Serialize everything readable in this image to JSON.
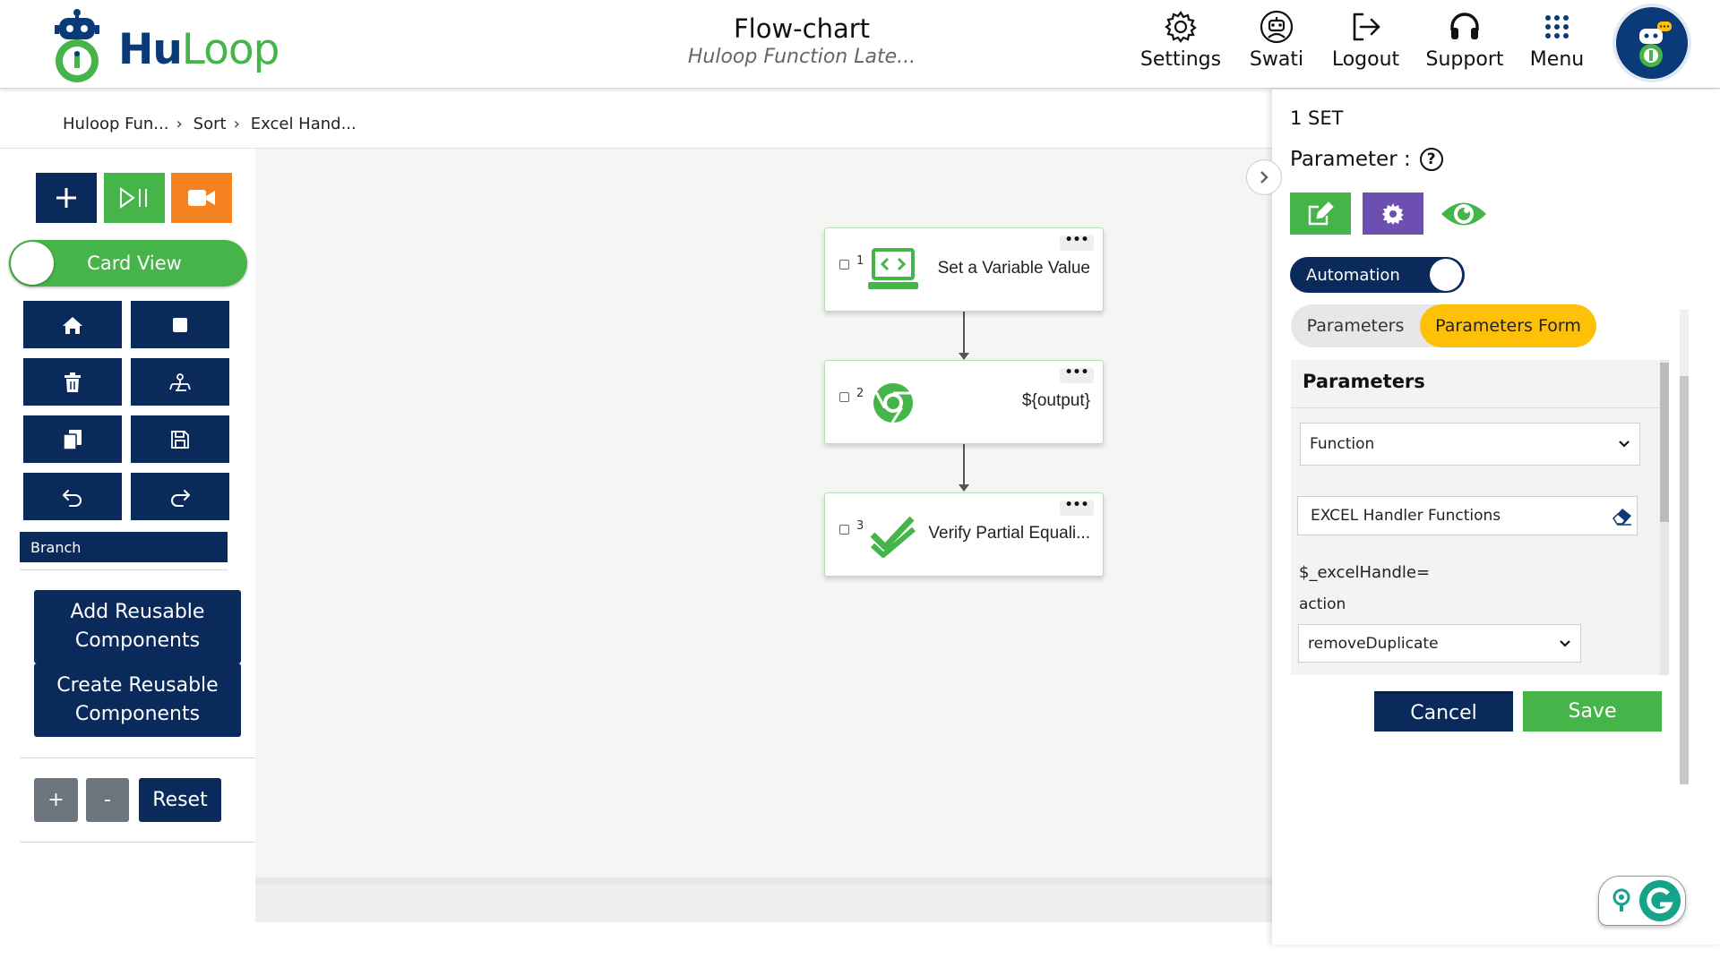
{
  "header": {
    "logo": {
      "hu": "Hu",
      "loop": "Loop"
    },
    "title": "Flow-chart",
    "subtitle": "Huloop Function Late...",
    "nav": [
      {
        "label": "Settings",
        "icon": "gear-icon"
      },
      {
        "label": "Swati",
        "icon": "robot-user-icon"
      },
      {
        "label": "Logout",
        "icon": "logout-icon"
      },
      {
        "label": "Support",
        "icon": "headset-icon"
      },
      {
        "label": "Menu",
        "icon": "grid-menu-icon"
      }
    ]
  },
  "breadcrumb": [
    "Huloop Fun...",
    "Sort",
    "Excel Hand..."
  ],
  "toolbar": {
    "card_view_label": "Card View",
    "branch_label": "Branch",
    "add_reusable": "Add Reusable Components",
    "create_reusable": "Create Reusable Components",
    "zoom_in": "+",
    "zoom_out": "-",
    "reset": "Reset"
  },
  "flow": {
    "nodes": [
      {
        "num": "1",
        "label": "Set a Variable Value",
        "icon": "laptop-code-icon"
      },
      {
        "num": "2",
        "label": "${output}",
        "icon": "chrome-icon"
      },
      {
        "num": "3",
        "label": "Verify Partial Equali...",
        "icon": "double-check-icon"
      }
    ],
    "menu_label": "•••"
  },
  "panel": {
    "set_label": "1 SET",
    "parameter_label": "Parameter :",
    "help": "?",
    "automation_label": "Automation",
    "tabs": {
      "parameters": "Parameters",
      "parameters_form": "Parameters Form"
    },
    "form": {
      "title": "Parameters",
      "function_select": "Function",
      "handler_value": "EXCEL Handler Functions",
      "excel_handle_label": "$_excelHandle=",
      "action_label": "action",
      "action_select": "removeDuplicate"
    },
    "cancel": "Cancel",
    "save": "Save"
  },
  "colors": {
    "navy": "#0a2a5c",
    "green": "#46b549",
    "orange": "#f58220",
    "purple": "#6c4fb0",
    "yellow": "#ffc107"
  }
}
